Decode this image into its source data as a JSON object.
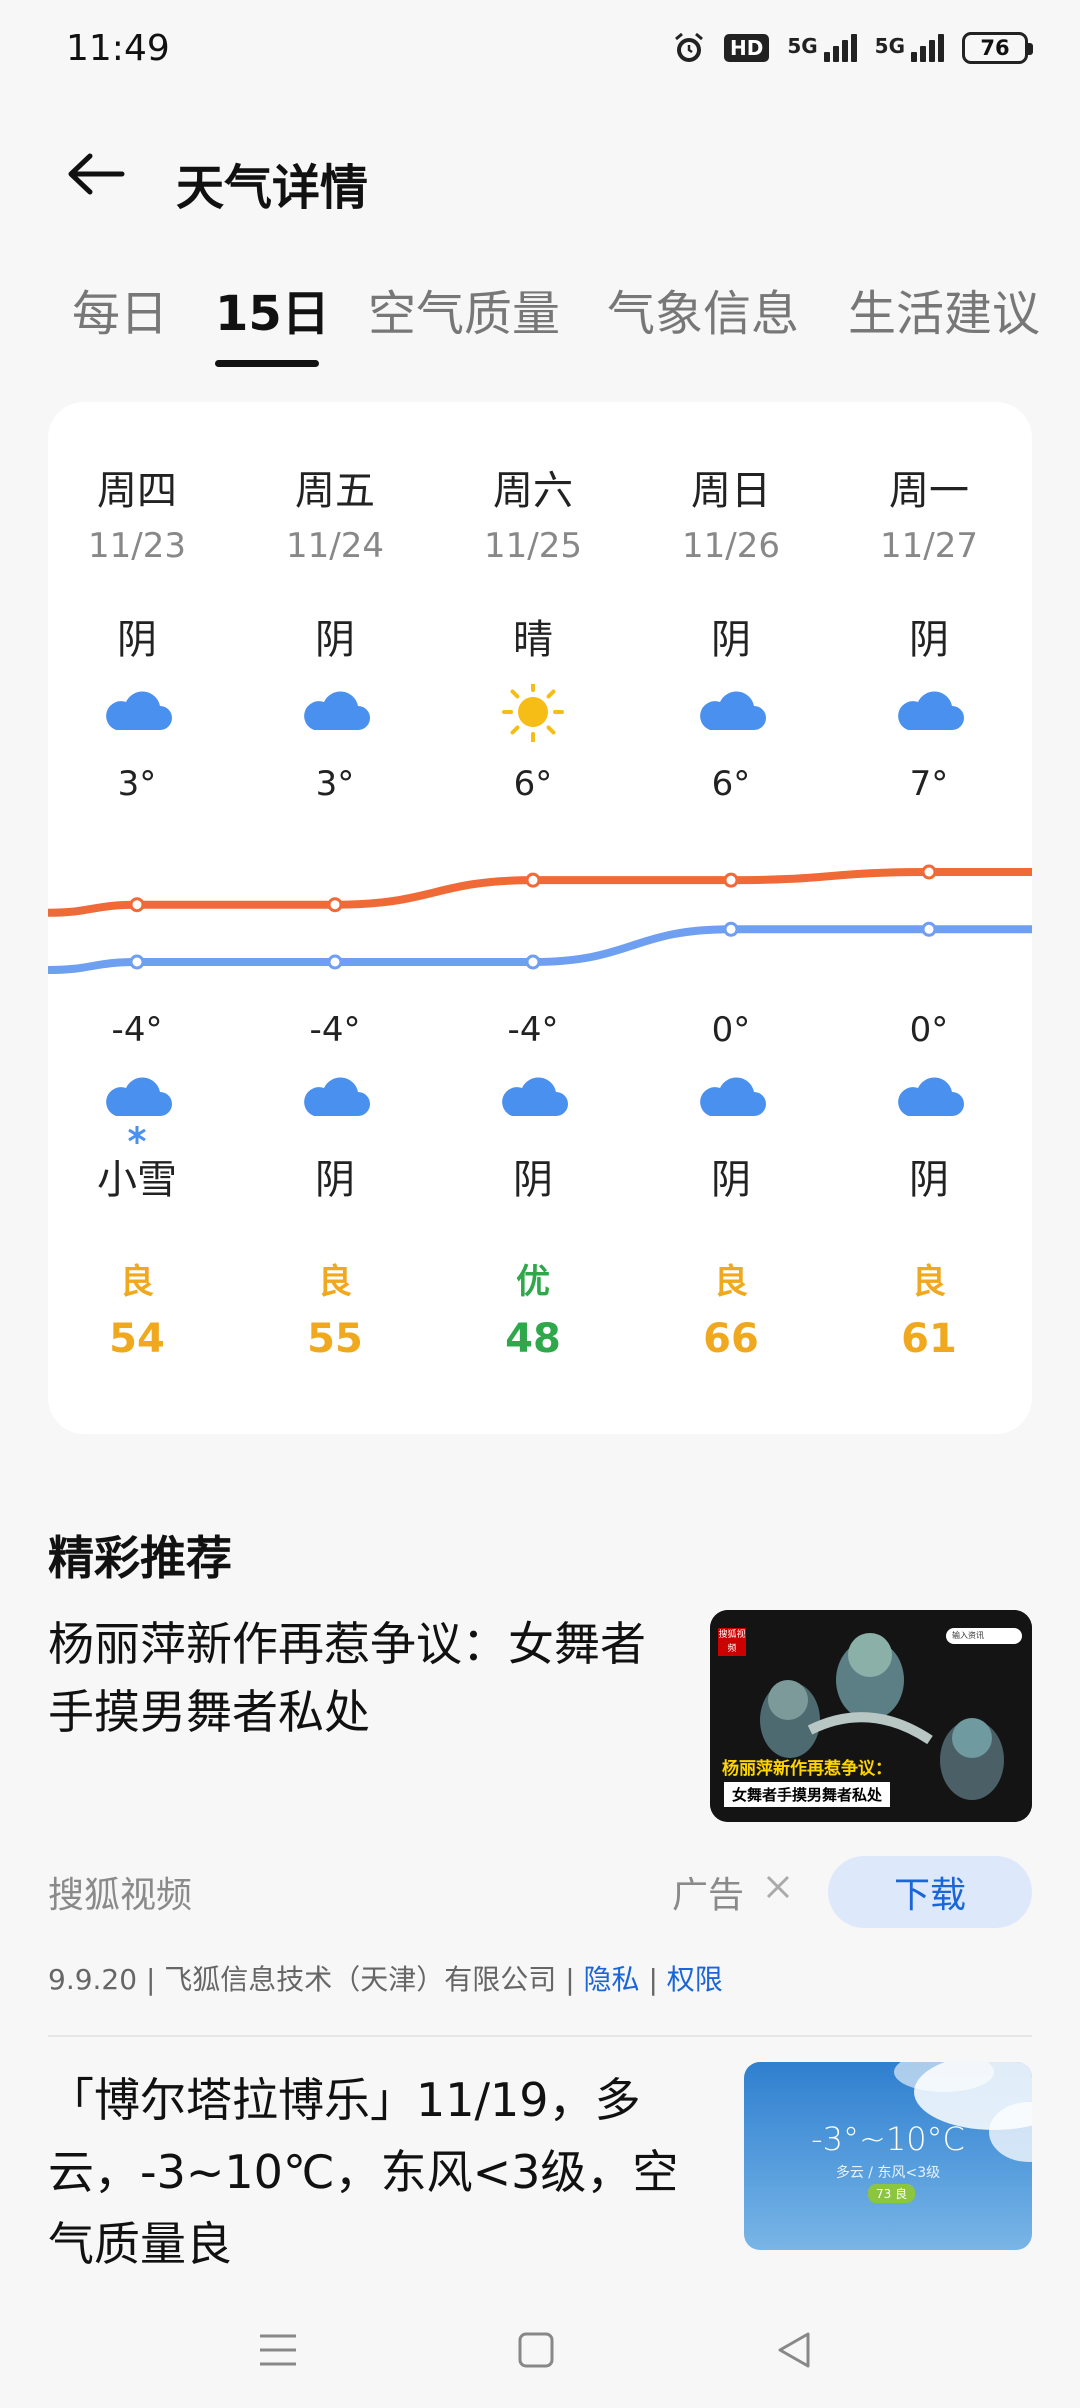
{
  "status_bar": {
    "time": "11:49",
    "hd_label": "HD",
    "signal1_label": "5G",
    "signal2_label": "5G",
    "battery": "76"
  },
  "header": {
    "title": "天气详情"
  },
  "tabs": [
    {
      "label": "每日",
      "active": false
    },
    {
      "label": "15日",
      "active": true
    },
    {
      "label": "空气质量",
      "active": false
    },
    {
      "label": "气象信息",
      "active": false
    },
    {
      "label": "生活建议",
      "active": false
    }
  ],
  "forecast": {
    "days": [
      {
        "name": "周四",
        "date": "11/23",
        "day_weather": "阴",
        "day_icon": "cloud-icon",
        "high": "3°",
        "low": "-4°",
        "night_icon": "snow-cloud-icon",
        "night_weather": "小雪",
        "aqi_level": "良",
        "aqi_value": "54",
        "aqi_color": "#f0a81e"
      },
      {
        "name": "周五",
        "date": "11/24",
        "day_weather": "阴",
        "day_icon": "cloud-icon",
        "high": "3°",
        "low": "-4°",
        "night_icon": "cloud-icon",
        "night_weather": "阴",
        "aqi_level": "良",
        "aqi_value": "55",
        "aqi_color": "#f0a81e"
      },
      {
        "name": "周六",
        "date": "11/25",
        "day_weather": "晴",
        "day_icon": "sun-icon",
        "high": "6°",
        "low": "-4°",
        "night_icon": "cloud-icon",
        "night_weather": "阴",
        "aqi_level": "优",
        "aqi_value": "48",
        "aqi_color": "#2ea84a"
      },
      {
        "name": "周日",
        "date": "11/26",
        "day_weather": "阴",
        "day_icon": "cloud-icon",
        "high": "6°",
        "low": "0°",
        "night_icon": "cloud-icon",
        "night_weather": "阴",
        "aqi_level": "良",
        "aqi_value": "66",
        "aqi_color": "#f0a81e"
      },
      {
        "name": "周一",
        "date": "11/27",
        "day_weather": "阴",
        "day_icon": "cloud-icon",
        "high": "7°",
        "low": "0°",
        "night_icon": "cloud-icon",
        "night_weather": "阴",
        "aqi_level": "良",
        "aqi_value": "61",
        "aqi_color": "#f0a81e"
      }
    ],
    "high_values": [
      3,
      3,
      6,
      6,
      7
    ],
    "low_values": [
      -4,
      -4,
      -4,
      0,
      0
    ],
    "high_color": "#f06a38",
    "low_color": "#6e9ff0"
  },
  "recommend": {
    "section_title": "精彩推荐",
    "news1": {
      "title": "杨丽萍新作再惹争议：女舞者手摸男舞者私处",
      "thumb_caption_line1": "杨丽萍新作再惹争议：",
      "thumb_caption_line2": "女舞者手摸男舞者私处",
      "thumb_logo": "搜狐视频",
      "thumb_search": "输入资讯"
    },
    "source": "搜狐视频",
    "ad_label": "广告",
    "download_label": "下载",
    "publisher": {
      "version": "9.9.20",
      "company": "飞狐信息技术（天津）有限公司",
      "privacy": "隐私",
      "permissions": "权限"
    },
    "news2": {
      "title": "「博尔塔拉博乐」11/19，多云，-3~10℃，东风<3级，空气质量良",
      "thumb_temp": "-3°~10°C",
      "thumb_sub": "多云 / 东风<3级",
      "thumb_aqi": "73 良"
    }
  }
}
